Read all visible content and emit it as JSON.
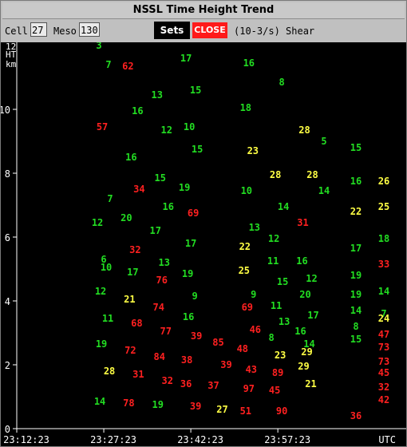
{
  "window": {
    "title": "NSSL Time Height Trend"
  },
  "toolbar": {
    "cell_label": "Cell",
    "cell_value": "27",
    "meso_label": "Meso",
    "meso_value": "130",
    "sets_label": "Sets",
    "close_label": "CLOSE",
    "units_label": "(10-3/s) Shear"
  },
  "colors": {
    "background": "#000000",
    "green": "#22dd22",
    "red": "#ff2020",
    "yellow": "#ffff44",
    "axis": "#ffffff"
  },
  "chart_data": {
    "type": "scatter",
    "ylabel_lines": [
      "12",
      "HT",
      "km"
    ],
    "ylim": [
      0,
      12
    ],
    "yticks": [
      0,
      2,
      4,
      6,
      8,
      10
    ],
    "xticks": [
      "23:12:23",
      "23:27:23",
      "23:42:23",
      "23:57:23"
    ],
    "x_unit_label": "UTC",
    "xlim": [
      "23:12:23",
      "24:07:23"
    ],
    "points": [
      {
        "t": "23:27:23",
        "h": 12.0,
        "v": "3",
        "c": "green"
      },
      {
        "t": "23:27:23",
        "h": 11.4,
        "v": "7",
        "c": "green"
      },
      {
        "t": "23:27:23",
        "h": 9.45,
        "v": "57",
        "c": "red"
      },
      {
        "t": "23:27:23",
        "h": 7.2,
        "v": "7",
        "c": "green"
      },
      {
        "t": "23:27:23",
        "h": 6.45,
        "v": "12",
        "c": "green"
      },
      {
        "t": "23:27:23",
        "h": 5.05,
        "v": "10",
        "c": "green"
      },
      {
        "t": "23:27:23",
        "h": 5.3,
        "v": "6",
        "c": "green"
      },
      {
        "t": "23:27:23",
        "h": 4.3,
        "v": "12",
        "c": "green"
      },
      {
        "t": "23:27:23",
        "h": 3.45,
        "v": "11",
        "c": "green"
      },
      {
        "t": "23:27:23",
        "h": 2.65,
        "v": "19",
        "c": "green"
      },
      {
        "t": "23:27:23",
        "h": 1.8,
        "v": "28",
        "c": "yellow"
      },
      {
        "t": "23:27:23",
        "h": 0.85,
        "v": "14",
        "c": "green"
      },
      {
        "t": "23:32:23",
        "h": 11.35,
        "v": "62",
        "c": "red"
      },
      {
        "t": "23:32:23",
        "h": 9.95,
        "v": "16",
        "c": "green"
      },
      {
        "t": "23:32:23",
        "h": 8.5,
        "v": "16",
        "c": "green"
      },
      {
        "t": "23:32:23",
        "h": 7.5,
        "v": "34",
        "c": "red"
      },
      {
        "t": "23:32:23",
        "h": 6.6,
        "v": "20",
        "c": "green"
      },
      {
        "t": "23:32:23",
        "h": 5.6,
        "v": "32",
        "c": "red"
      },
      {
        "t": "23:32:23",
        "h": 4.9,
        "v": "17",
        "c": "green"
      },
      {
        "t": "23:32:23",
        "h": 4.05,
        "v": "21",
        "c": "yellow"
      },
      {
        "t": "23:32:23",
        "h": 3.3,
        "v": "68",
        "c": "red"
      },
      {
        "t": "23:32:23",
        "h": 2.45,
        "v": "72",
        "c": "red"
      },
      {
        "t": "23:32:23",
        "h": 1.7,
        "v": "31",
        "c": "red"
      },
      {
        "t": "23:32:23",
        "h": 0.8,
        "v": "78",
        "c": "red"
      },
      {
        "t": "23:37:23",
        "h": 10.45,
        "v": "13",
        "c": "green"
      },
      {
        "t": "23:37:23",
        "h": 9.35,
        "v": "12",
        "c": "green"
      },
      {
        "t": "23:37:23",
        "h": 7.85,
        "v": "15",
        "c": "green"
      },
      {
        "t": "23:37:23",
        "h": 6.95,
        "v": "16",
        "c": "green"
      },
      {
        "t": "23:37:23",
        "h": 6.2,
        "v": "17",
        "c": "green"
      },
      {
        "t": "23:37:23",
        "h": 5.2,
        "v": "13",
        "c": "green"
      },
      {
        "t": "23:37:23",
        "h": 4.65,
        "v": "76",
        "c": "red"
      },
      {
        "t": "23:37:23",
        "h": 3.8,
        "v": "74",
        "c": "red"
      },
      {
        "t": "23:37:23",
        "h": 3.05,
        "v": "77",
        "c": "red"
      },
      {
        "t": "23:37:23",
        "h": 2.25,
        "v": "84",
        "c": "red"
      },
      {
        "t": "23:37:23",
        "h": 1.5,
        "v": "32",
        "c": "red"
      },
      {
        "t": "23:37:23",
        "h": 0.75,
        "v": "19",
        "c": "green"
      },
      {
        "t": "23:42:23",
        "h": 11.6,
        "v": "17",
        "c": "green"
      },
      {
        "t": "23:42:23",
        "h": 10.6,
        "v": "15",
        "c": "green"
      },
      {
        "t": "23:42:23",
        "h": 9.45,
        "v": "10",
        "c": "green"
      },
      {
        "t": "23:42:23",
        "h": 8.75,
        "v": "15",
        "c": "green"
      },
      {
        "t": "23:42:23",
        "h": 7.55,
        "v": "19",
        "c": "green"
      },
      {
        "t": "23:42:23",
        "h": 6.75,
        "v": "69",
        "c": "red"
      },
      {
        "t": "23:42:23",
        "h": 5.8,
        "v": "17",
        "c": "green"
      },
      {
        "t": "23:42:23",
        "h": 4.85,
        "v": "19",
        "c": "green"
      },
      {
        "t": "23:42:23",
        "h": 4.15,
        "v": "9",
        "c": "green"
      },
      {
        "t": "23:42:23",
        "h": 3.5,
        "v": "16",
        "c": "green"
      },
      {
        "t": "23:42:23",
        "h": 2.9,
        "v": "39",
        "c": "red"
      },
      {
        "t": "23:42:23",
        "h": 2.15,
        "v": "38",
        "c": "red"
      },
      {
        "t": "23:42:23",
        "h": 1.4,
        "v": "36",
        "c": "red"
      },
      {
        "t": "23:42:23",
        "h": 0.7,
        "v": "39",
        "c": "red"
      },
      {
        "t": "23:47:23",
        "h": 2.7,
        "v": "85",
        "c": "red"
      },
      {
        "t": "23:47:23",
        "h": 2.0,
        "v": "39",
        "c": "red"
      },
      {
        "t": "23:47:23",
        "h": 1.35,
        "v": "37",
        "c": "red"
      },
      {
        "t": "23:47:23",
        "h": 0.6,
        "v": "27",
        "c": "yellow"
      },
      {
        "t": "23:52:23",
        "h": 11.45,
        "v": "16",
        "c": "green"
      },
      {
        "t": "23:52:23",
        "h": 10.05,
        "v": "18",
        "c": "green"
      },
      {
        "t": "23:52:23",
        "h": 8.7,
        "v": "23",
        "c": "yellow"
      },
      {
        "t": "23:52:23",
        "h": 7.45,
        "v": "10",
        "c": "green"
      },
      {
        "t": "23:52:23",
        "h": 6.3,
        "v": "13",
        "c": "green"
      },
      {
        "t": "23:52:23",
        "h": 5.7,
        "v": "22",
        "c": "yellow"
      },
      {
        "t": "23:52:23",
        "h": 4.95,
        "v": "25",
        "c": "yellow"
      },
      {
        "t": "23:52:23",
        "h": 4.2,
        "v": "9",
        "c": "green"
      },
      {
        "t": "23:52:23",
        "h": 3.8,
        "v": "69",
        "c": "red"
      },
      {
        "t": "23:52:23",
        "h": 3.1,
        "v": "46",
        "c": "red"
      },
      {
        "t": "23:52:23",
        "h": 2.5,
        "v": "48",
        "c": "red"
      },
      {
        "t": "23:52:23",
        "h": 1.85,
        "v": "43",
        "c": "red"
      },
      {
        "t": "23:52:23",
        "h": 1.25,
        "v": "97",
        "c": "red"
      },
      {
        "t": "23:52:23",
        "h": 0.55,
        "v": "51",
        "c": "red"
      },
      {
        "t": "23:57:23",
        "h": 10.85,
        "v": "8",
        "c": "green"
      },
      {
        "t": "23:57:23",
        "h": 7.95,
        "v": "28",
        "c": "yellow"
      },
      {
        "t": "23:57:23",
        "h": 6.95,
        "v": "14",
        "c": "green"
      },
      {
        "t": "23:57:23",
        "h": 5.95,
        "v": "12",
        "c": "green"
      },
      {
        "t": "23:57:23",
        "h": 5.25,
        "v": "11",
        "c": "green"
      },
      {
        "t": "23:57:23",
        "h": 4.6,
        "v": "15",
        "c": "green"
      },
      {
        "t": "23:57:23",
        "h": 3.85,
        "v": "11",
        "c": "green"
      },
      {
        "t": "23:57:23",
        "h": 3.35,
        "v": "13",
        "c": "green"
      },
      {
        "t": "23:57:23",
        "h": 2.85,
        "v": "8",
        "c": "green"
      },
      {
        "t": "23:57:23",
        "h": 2.3,
        "v": "23",
        "c": "yellow"
      },
      {
        "t": "23:57:23",
        "h": 1.75,
        "v": "89",
        "c": "red"
      },
      {
        "t": "23:57:23",
        "h": 1.2,
        "v": "45",
        "c": "red"
      },
      {
        "t": "23:57:23",
        "h": 0.55,
        "v": "90",
        "c": "red"
      },
      {
        "t": "24:02:23",
        "h": 9.35,
        "v": "28",
        "c": "yellow"
      },
      {
        "t": "24:02:23",
        "h": 7.95,
        "v": "28",
        "c": "yellow"
      },
      {
        "t": "24:02:23",
        "h": 6.45,
        "v": "31",
        "c": "red"
      },
      {
        "t": "24:02:23",
        "h": 5.25,
        "v": "16",
        "c": "green"
      },
      {
        "t": "24:02:23",
        "h": 4.7,
        "v": "12",
        "c": "green"
      },
      {
        "t": "24:02:23",
        "h": 4.2,
        "v": "20",
        "c": "green"
      },
      {
        "t": "24:02:23",
        "h": 3.55,
        "v": "17",
        "c": "green"
      },
      {
        "t": "24:02:23",
        "h": 3.05,
        "v": "16",
        "c": "green"
      },
      {
        "t": "24:02:23",
        "h": 2.65,
        "v": "14",
        "c": "green"
      },
      {
        "t": "24:02:23",
        "h": 2.4,
        "v": "29",
        "c": "yellow"
      },
      {
        "t": "24:02:23",
        "h": 1.95,
        "v": "29",
        "c": "yellow"
      },
      {
        "t": "24:02:23",
        "h": 1.4,
        "v": "21",
        "c": "yellow"
      }
    ],
    "points_right": [
      {
        "col": 0,
        "h": 9.0,
        "v": "5",
        "c": "green"
      },
      {
        "col": 0,
        "h": 7.45,
        "v": "14",
        "c": "green"
      },
      {
        "col": 1,
        "h": 8.8,
        "v": "15",
        "c": "green"
      },
      {
        "col": 1,
        "h": 7.75,
        "v": "16",
        "c": "green"
      },
      {
        "col": 1,
        "h": 6.8,
        "v": "22",
        "c": "yellow"
      },
      {
        "col": 1,
        "h": 5.65,
        "v": "17",
        "c": "green"
      },
      {
        "col": 1,
        "h": 4.8,
        "v": "19",
        "c": "green"
      },
      {
        "col": 1,
        "h": 4.2,
        "v": "19",
        "c": "green"
      },
      {
        "col": 1,
        "h": 3.7,
        "v": "14",
        "c": "green"
      },
      {
        "col": 1,
        "h": 3.2,
        "v": "8",
        "c": "green"
      },
      {
        "col": 1,
        "h": 2.8,
        "v": "15",
        "c": "green"
      },
      {
        "col": 1,
        "h": 0.4,
        "v": "36",
        "c": "red"
      },
      {
        "col": 2,
        "h": 7.75,
        "v": "26",
        "c": "yellow"
      },
      {
        "col": 2,
        "h": 6.95,
        "v": "25",
        "c": "yellow"
      },
      {
        "col": 2,
        "h": 5.95,
        "v": "18",
        "c": "green"
      },
      {
        "col": 2,
        "h": 5.15,
        "v": "33",
        "c": "red"
      },
      {
        "col": 2,
        "h": 4.3,
        "v": "14",
        "c": "green"
      },
      {
        "col": 2,
        "h": 3.6,
        "v": "7",
        "c": "green"
      },
      {
        "col": 2,
        "h": 3.45,
        "v": "24",
        "c": "yellow"
      },
      {
        "col": 2,
        "h": 2.95,
        "v": "47",
        "c": "red"
      },
      {
        "col": 2,
        "h": 2.55,
        "v": "73",
        "c": "red"
      },
      {
        "col": 2,
        "h": 2.1,
        "v": "73",
        "c": "red"
      },
      {
        "col": 2,
        "h": 1.75,
        "v": "45",
        "c": "red"
      },
      {
        "col": 2,
        "h": 1.3,
        "v": "32",
        "c": "red"
      },
      {
        "col": 2,
        "h": 0.9,
        "v": "42",
        "c": "red"
      }
    ]
  }
}
